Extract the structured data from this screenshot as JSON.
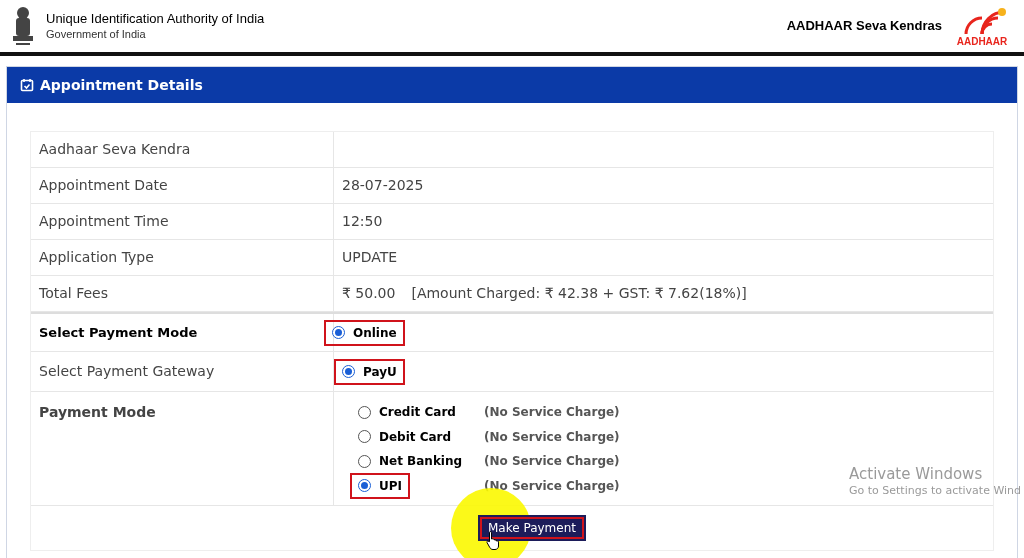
{
  "header": {
    "org": "Unique Identification Authority of India",
    "gov": "Government of India",
    "brand": "AADHAAR Seva Kendras",
    "logo_text": "AADHAAR"
  },
  "panel": {
    "title": "Appointment Details"
  },
  "details": [
    {
      "label": "Aadhaar Seva Kendra"
    },
    {
      "label": "Appointment Date",
      "value": "28-07-2025"
    },
    {
      "label": "Appointment Time",
      "value": "12:50"
    },
    {
      "label": "Application Type",
      "value": "UPDATE"
    },
    {
      "label": "Total Fees",
      "value": "₹ 50.00",
      "note": "[Amount Charged: ₹ 42.38 + GST: ₹ 7.62(18%)]"
    }
  ],
  "payment_mode": {
    "label": "Select Payment Mode",
    "option": "Online",
    "selected": true,
    "highlighted": true
  },
  "payment_gateway": {
    "label": "Select Payment Gateway",
    "option": "PayU",
    "selected": true,
    "highlighted": true
  },
  "payment_methods": {
    "label": "Payment Mode",
    "options": [
      {
        "label": "Credit Card",
        "charge": "(No Service Charge)",
        "selected": false,
        "highlighted": false
      },
      {
        "label": "Debit Card",
        "charge": "(No Service Charge)",
        "selected": false,
        "highlighted": false
      },
      {
        "label": "Net Banking",
        "charge": "(No Service Charge)",
        "selected": false,
        "highlighted": false
      },
      {
        "label": "UPI",
        "charge": "(No Service Charge)",
        "selected": true,
        "highlighted": true
      }
    ]
  },
  "submit": {
    "label": "Make Payment",
    "highlighted": true
  },
  "os_notice": {
    "title": "Activate Windows",
    "subtitle": "Go to Settings to activate Wind"
  }
}
